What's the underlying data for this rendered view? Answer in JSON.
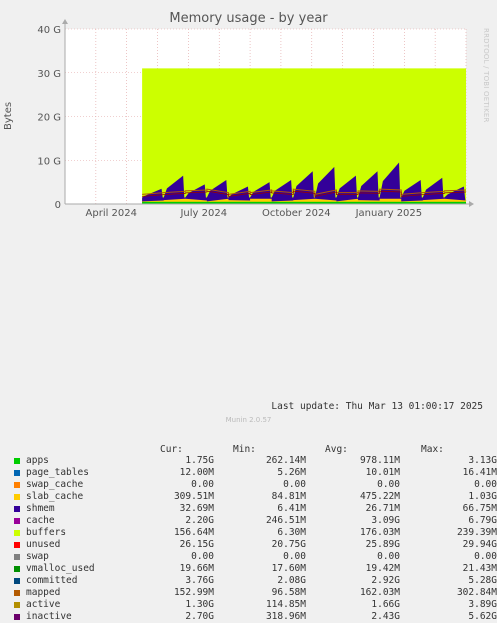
{
  "title": "Memory usage - by year",
  "ylabel": "Bytes",
  "side_label": "RRDTOOL / TOBI OETIKER",
  "footer": "Last update: Thu Mar 13 01:00:17 2025",
  "munin": "Munin 2.0.57",
  "headers": {
    "cur": "Cur:",
    "min": "Min:",
    "avg": "Avg:",
    "max": "Max:"
  },
  "legend": [
    {
      "name": "apps",
      "color": "#00cc00",
      "cur": "1.75G",
      "min": "262.14M",
      "avg": "978.11M",
      "max": "3.13G"
    },
    {
      "name": "page_tables",
      "color": "#0066b3",
      "cur": "12.00M",
      "min": "5.26M",
      "avg": "10.01M",
      "max": "16.41M"
    },
    {
      "name": "swap_cache",
      "color": "#ff8000",
      "cur": "0.00",
      "min": "0.00",
      "avg": "0.00",
      "max": "0.00"
    },
    {
      "name": "slab_cache",
      "color": "#ffcc00",
      "cur": "309.51M",
      "min": "84.81M",
      "avg": "475.22M",
      "max": "1.03G"
    },
    {
      "name": "shmem",
      "color": "#330099",
      "cur": "32.69M",
      "min": "6.41M",
      "avg": "26.71M",
      "max": "66.75M"
    },
    {
      "name": "cache",
      "color": "#990099",
      "cur": "2.20G",
      "min": "246.51M",
      "avg": "3.09G",
      "max": "6.79G"
    },
    {
      "name": "buffers",
      "color": "#ccff00",
      "cur": "156.64M",
      "min": "6.30M",
      "avg": "176.03M",
      "max": "239.39M"
    },
    {
      "name": "unused",
      "color": "#ff0000",
      "cur": "26.15G",
      "min": "20.75G",
      "avg": "25.89G",
      "max": "29.94G"
    },
    {
      "name": "swap",
      "color": "#808080",
      "cur": "0.00",
      "min": "0.00",
      "avg": "0.00",
      "max": "0.00"
    },
    {
      "name": "vmalloc_used",
      "color": "#008f00",
      "cur": "19.66M",
      "min": "17.60M",
      "avg": "19.42M",
      "max": "21.43M"
    },
    {
      "name": "committed",
      "color": "#00487d",
      "cur": "3.76G",
      "min": "2.08G",
      "avg": "2.92G",
      "max": "5.28G"
    },
    {
      "name": "mapped",
      "color": "#b35a00",
      "cur": "152.99M",
      "min": "96.58M",
      "avg": "162.03M",
      "max": "302.84M"
    },
    {
      "name": "active",
      "color": "#b38f00",
      "cur": "1.30G",
      "min": "114.85M",
      "avg": "1.66G",
      "max": "3.89G"
    },
    {
      "name": "inactive",
      "color": "#6b006b",
      "cur": "2.70G",
      "min": "318.96M",
      "avg": "2.43G",
      "max": "5.62G"
    }
  ],
  "chart_data": {
    "type": "area",
    "title": "Memory usage - by year",
    "ylabel": "Bytes",
    "yticks": [
      "0",
      "10 G",
      "20 G",
      "30 G",
      "40 G"
    ],
    "ylim": [
      0,
      40
    ],
    "xticks": [
      "April 2024",
      "July 2024",
      "October 2024",
      "January 2025"
    ],
    "total_gb": 31,
    "data_start_month": 2.5,
    "cache_peaks_gb": [
      3.5,
      6.5,
      4.5,
      5.5,
      4.0,
      5.0,
      5.5,
      7.5,
      8.5,
      6.5,
      7.5,
      9.5,
      5.5,
      6.0,
      4.0
    ]
  }
}
